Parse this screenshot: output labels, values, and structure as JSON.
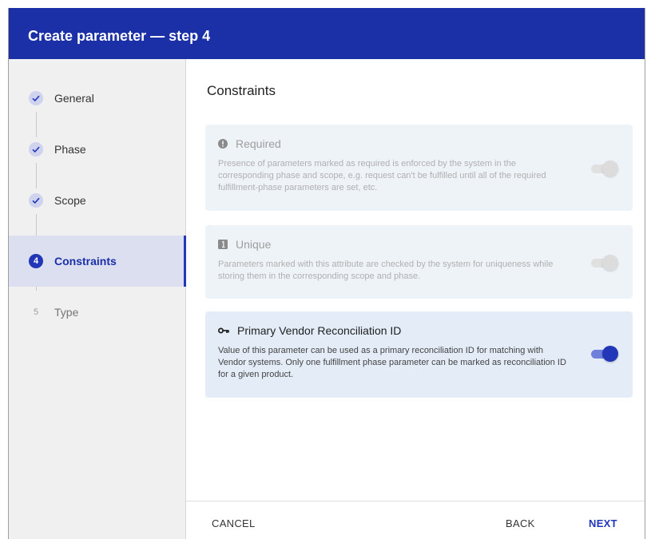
{
  "header": {
    "title": "Create parameter — step 4"
  },
  "steps": [
    {
      "badge": "✓",
      "label": "General",
      "state": "done"
    },
    {
      "badge": "✓",
      "label": "Phase",
      "state": "done"
    },
    {
      "badge": "✓",
      "label": "Scope",
      "state": "done"
    },
    {
      "badge": "4",
      "label": "Constraints",
      "state": "current"
    },
    {
      "badge": "5",
      "label": "Type",
      "state": "pending"
    }
  ],
  "main": {
    "heading": "Constraints",
    "constraints": [
      {
        "icon": "exclamation-circle-icon",
        "title": "Required",
        "description": "Presence of parameters marked as required is enforced by the system in the corresponding phase and scope, e.g. request can't be fulfilled until all of the required fulfillment-phase parameters are set, etc.",
        "enabled": false,
        "checked": false
      },
      {
        "icon": "number-one-box-icon",
        "title": "Unique",
        "description": "Parameters marked with this attribute are checked by the system for uniqueness while storing them in the corresponding scope and phase.",
        "enabled": false,
        "checked": false
      },
      {
        "icon": "key-icon",
        "title": "Primary Vendor Reconciliation ID",
        "description": "Value of this parameter can be used as a primary reconciliation ID for matching with Vendor systems. Only one fulfillment phase parameter can be marked as reconciliation ID for a given product.",
        "enabled": true,
        "checked": true
      }
    ]
  },
  "footer": {
    "cancel_label": "CANCEL",
    "back_label": "BACK",
    "next_label": "NEXT"
  },
  "colors": {
    "header_bg": "#1b2fa6",
    "accent": "#2236b8",
    "sidebar_bg": "#f0f0f0",
    "card_bg": "#e4edf7"
  }
}
